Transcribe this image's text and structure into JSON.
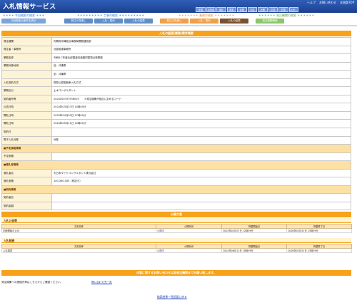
{
  "header": {
    "title": "入札情報サービス",
    "links": [
      "ヘルプ",
      "お問い合わせ",
      "全国版TOP"
    ],
    "regions": [
      "全国",
      "北海道",
      "東北",
      "関東",
      "北陸",
      "中部",
      "近畿",
      "中国",
      "四国",
      "九州・沖縄"
    ]
  },
  "nav": {
    "groups": [
      {
        "title": "＊＊＊＊ 今回検索の検索 ＊＊＊＊",
        "tabs": [
          "今回検索の条件を表示"
        ]
      },
      {
        "title": "＊＊＊＊＊＊＊＊＊ 工事の検索 ＊＊＊＊＊＊＊＊＊",
        "tabs": [
          "発注の見通し",
          "入札・契約",
          "入札の結果"
        ]
      },
      {
        "title": "＊＊＊＊＊＊＊ 業務の検索 ＊＊＊＊＊＊＊",
        "tabs": [
          "発注の見通し",
          "入札・契約",
          "入札の結果"
        ]
      },
      {
        "title": "＊＊＊＊＊＊ 発注機関の検索 ＊＊＊＊＊＊",
        "tabs": [
          "発注機関情報"
        ]
      }
    ]
  },
  "main": {
    "title": "入札の経過(業務)案件概要",
    "rows": [
      {
        "label": "発注機関",
        "value": "内閣府沖縄総合事務局開発建設部"
      },
      {
        "label": "発注者・事務所",
        "value": "北部国道事務所"
      },
      {
        "label": "業務名称",
        "value": "令和6-7年度北部国道内道路附属物点検業務"
      },
      {
        "label": "業務対象地域",
        "value": "自：沖縄県"
      },
      {
        "label": "",
        "value": "至：沖縄県"
      },
      {
        "label": "入札契約方式",
        "value": "簡易公募型競争入札方式"
      },
      {
        "label": "業務区分",
        "value": "土木コンサルタント"
      },
      {
        "label": "契約番号等",
        "value": "2024000337936019　　＊発注機関が独自に定めるコード"
      },
      {
        "label": "公告日時",
        "value": "2024年03月27日 10時00分"
      },
      {
        "label": "開札日時",
        "value": "2024年04月05日 17時00分"
      },
      {
        "label": "開札日時",
        "value": "2024年05月11日 10時00分"
      },
      {
        "label": "契約日",
        "value": ""
      },
      {
        "label": "電子入札対象",
        "value": "対象"
      },
      {
        "section": "■予定価格情報"
      },
      {
        "label": "予定価格",
        "value": ""
      },
      {
        "section": "■落札者情報"
      },
      {
        "label": "落札者名",
        "value": "大日本ダイヤコンサルタント株式会社"
      },
      {
        "label": "落札価格",
        "value": "100,360,000（税抜き）"
      },
      {
        "section": "■契約情報"
      },
      {
        "label": "契約者名",
        "value": ""
      },
      {
        "label": "契約金額",
        "value": ""
      }
    ]
  },
  "documents": {
    "title": "公開文書",
    "groups": [
      {
        "heading": "入札公告等",
        "columns": [
          "文書名称",
          "公開状況",
          "掲載開始日",
          "掲載終了日"
        ],
        "rows": [
          [
            "手続開始の公示",
            "公開中",
            "2024年03月27日 12時59分",
            "2026年03月31日 23時59分"
          ]
        ]
      },
      {
        "heading": "入札経過",
        "columns": [
          "文書名称",
          "公開状況",
          "掲載開始日",
          "掲載終了日"
        ],
        "rows": [
          [
            "入札調書",
            "公開中",
            "2024年06月11日 18時59分",
            "2026年03月31日 23時59分"
          ]
        ]
      }
    ]
  },
  "inquiry": {
    "bar": "内容に関するお問い合わせは各発注機関までお願い致します。",
    "text": "発注機関への連絡先等はこちらからご確認ください。",
    "link": "問い合わせ先一覧"
  },
  "back_link": "検索結果一覧画面に戻る"
}
